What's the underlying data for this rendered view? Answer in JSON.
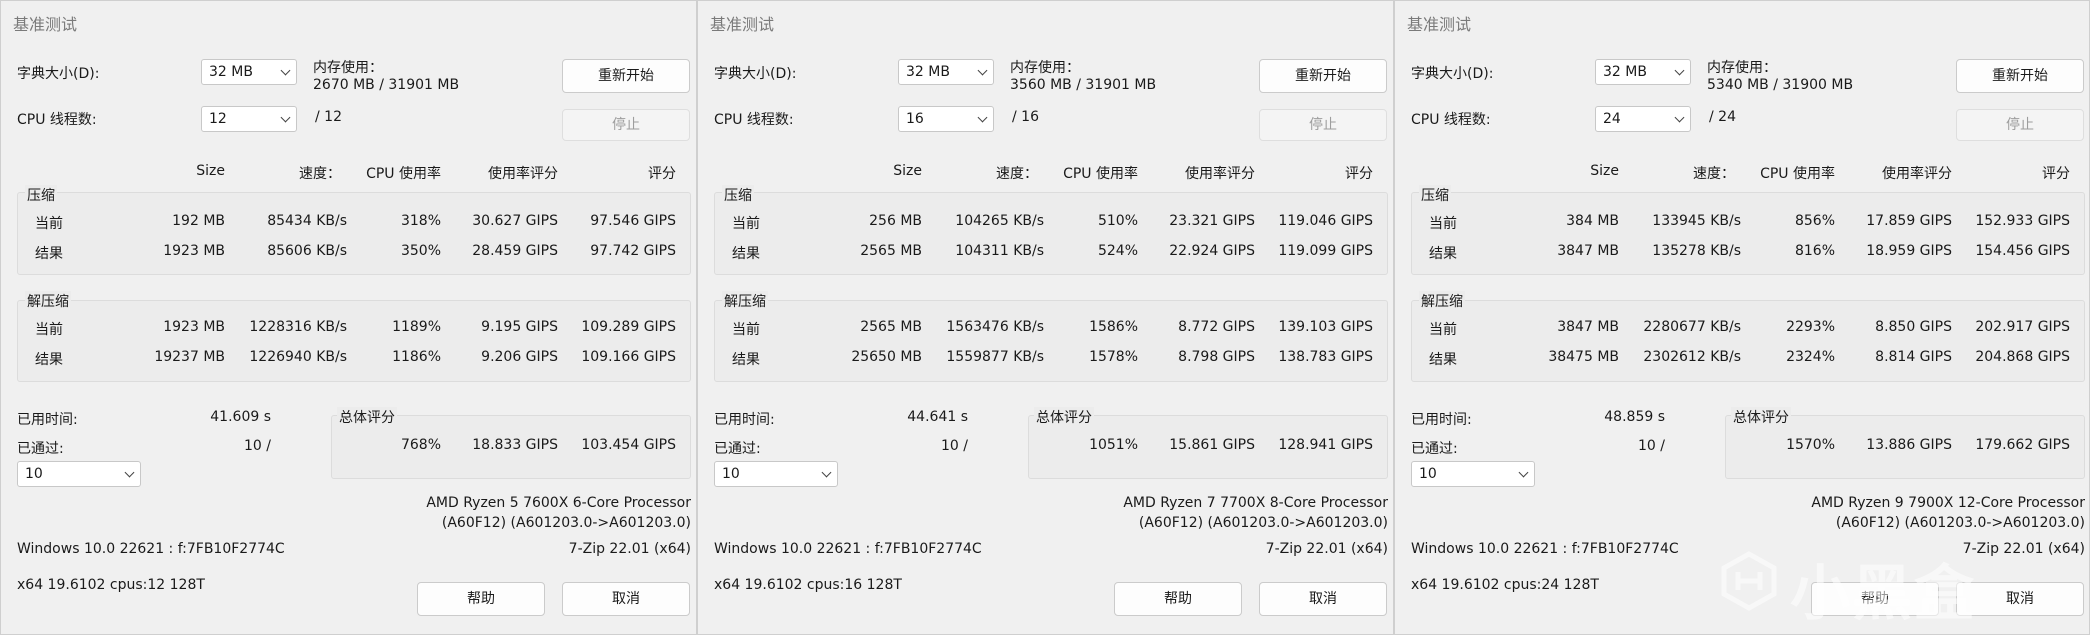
{
  "labels": {
    "window_title": "基准测试",
    "dict_size": "字典大小(D):",
    "memory_usage": "内存使用：",
    "cpu_threads": "CPU 线程数:",
    "restart": "重新开始",
    "stop": "停止",
    "col_size": "Size",
    "col_speed": "速度：",
    "col_cpu_usage": "CPU 使用率",
    "col_rating_usage": "使用率评分",
    "col_rating": "评分",
    "compress": "压缩",
    "decompress": "解压缩",
    "current": "当前",
    "result": "结果",
    "elapsed": "已用时间:",
    "passed": "已通过:",
    "total_rating": "总体评分",
    "help": "帮助",
    "cancel": "取消"
  },
  "windows": [
    {
      "dict_size": "32 MB",
      "memory": "2670 MB / 31901 MB",
      "threads": "12",
      "threads_max": "/ 12",
      "compress_current": {
        "size": "192 MB",
        "speed": "85434 KB/s",
        "usage": "318%",
        "rating_usage": "30.627 GIPS",
        "rating": "97.546 GIPS"
      },
      "compress_result": {
        "size": "1923 MB",
        "speed": "85606 KB/s",
        "usage": "350%",
        "rating_usage": "28.459 GIPS",
        "rating": "97.742 GIPS"
      },
      "decompress_current": {
        "size": "1923 MB",
        "speed": "1228316 KB/s",
        "usage": "1189%",
        "rating_usage": "9.195 GIPS",
        "rating": "109.289 GIPS"
      },
      "decompress_result": {
        "size": "19237 MB",
        "speed": "1226940 KB/s",
        "usage": "1186%",
        "rating_usage": "9.206 GIPS",
        "rating": "109.166 GIPS"
      },
      "elapsed": "41.609 s",
      "passed": "10 /",
      "passes_select": "10",
      "total": {
        "usage": "768%",
        "rating_usage": "18.833 GIPS",
        "rating": "103.454 GIPS"
      },
      "cpu_line1": "AMD Ryzen 5 7600X 6-Core Processor",
      "cpu_line2": "(A60F12) (A601203.0->A601203.0)",
      "os": "Windows 10.0 22621 : f:7FB10F2774C",
      "version": "7-Zip 22.01 (x64)",
      "arch": "x64 19.6102 cpus:12 128T"
    },
    {
      "dict_size": "32 MB",
      "memory": "3560 MB / 31901 MB",
      "threads": "16",
      "threads_max": "/ 16",
      "compress_current": {
        "size": "256 MB",
        "speed": "104265 KB/s",
        "usage": "510%",
        "rating_usage": "23.321 GIPS",
        "rating": "119.046 GIPS"
      },
      "compress_result": {
        "size": "2565 MB",
        "speed": "104311 KB/s",
        "usage": "524%",
        "rating_usage": "22.924 GIPS",
        "rating": "119.099 GIPS"
      },
      "decompress_current": {
        "size": "2565 MB",
        "speed": "1563476 KB/s",
        "usage": "1586%",
        "rating_usage": "8.772 GIPS",
        "rating": "139.103 GIPS"
      },
      "decompress_result": {
        "size": "25650 MB",
        "speed": "1559877 KB/s",
        "usage": "1578%",
        "rating_usage": "8.798 GIPS",
        "rating": "138.783 GIPS"
      },
      "elapsed": "44.641 s",
      "passed": "10 /",
      "passes_select": "10",
      "total": {
        "usage": "1051%",
        "rating_usage": "15.861 GIPS",
        "rating": "128.941 GIPS"
      },
      "cpu_line1": "AMD Ryzen 7 7700X 8-Core Processor",
      "cpu_line2": "(A60F12) (A601203.0->A601203.0)",
      "os": "Windows 10.0 22621 : f:7FB10F2774C",
      "version": "7-Zip 22.01 (x64)",
      "arch": "x64 19.6102 cpus:16 128T"
    },
    {
      "dict_size": "32 MB",
      "memory": "5340 MB / 31900 MB",
      "threads": "24",
      "threads_max": "/ 24",
      "compress_current": {
        "size": "384 MB",
        "speed": "133945 KB/s",
        "usage": "856%",
        "rating_usage": "17.859 GIPS",
        "rating": "152.933 GIPS"
      },
      "compress_result": {
        "size": "3847 MB",
        "speed": "135278 KB/s",
        "usage": "816%",
        "rating_usage": "18.959 GIPS",
        "rating": "154.456 GIPS"
      },
      "decompress_current": {
        "size": "3847 MB",
        "speed": "2280677 KB/s",
        "usage": "2293%",
        "rating_usage": "8.850 GIPS",
        "rating": "202.917 GIPS"
      },
      "decompress_result": {
        "size": "38475 MB",
        "speed": "2302612 KB/s",
        "usage": "2324%",
        "rating_usage": "8.814 GIPS",
        "rating": "204.868 GIPS"
      },
      "elapsed": "48.859 s",
      "passed": "10 /",
      "passes_select": "10",
      "total": {
        "usage": "1570%",
        "rating_usage": "13.886 GIPS",
        "rating": "179.662 GIPS"
      },
      "cpu_line1": "AMD Ryzen 9 7900X 12-Core Processor",
      "cpu_line2": "(A60F12) (A601203.0->A601203.0)",
      "os": "Windows 10.0 22621 : f:7FB10F2774C",
      "version": "7-Zip 22.01 (x64)",
      "arch": "x64 19.6102 cpus:24 128T"
    }
  ],
  "watermark": "小黑盒"
}
